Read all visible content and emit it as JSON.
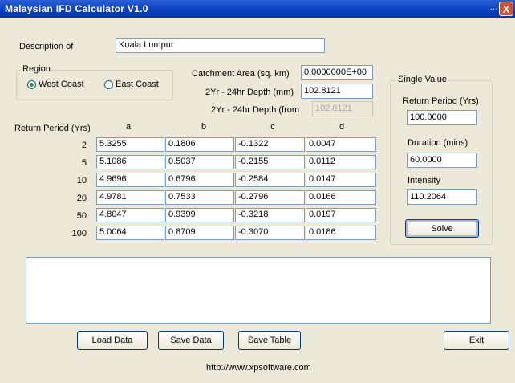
{
  "window": {
    "title": "Malaysian IFD Calculator V1.0",
    "title_dots": "...",
    "close_glyph": "X"
  },
  "description": {
    "label": "Description of",
    "value": "Kuala Lumpur"
  },
  "region": {
    "legend": "Region",
    "west_label": "West Coast",
    "east_label": "East Coast",
    "selected": "West Coast"
  },
  "catchment": {
    "label": "Catchment Area (sq. km)",
    "value": "0.0000000E+00"
  },
  "depth24": {
    "label": "2Yr - 24hr Depth (mm)",
    "value": "102.8121"
  },
  "depth24_from": {
    "label": "2Yr - 24hr Depth (from",
    "value": "102.8121"
  },
  "table": {
    "return_label": "Return Period (Yrs)",
    "columns": [
      "a",
      "b",
      "c",
      "d"
    ],
    "rows": [
      {
        "period": "2",
        "values": [
          "5.3255",
          "0.1806",
          "-0.1322",
          "0.0047"
        ]
      },
      {
        "period": "5",
        "values": [
          "5.1086",
          "0.5037",
          "-0.2155",
          "0.0112"
        ]
      },
      {
        "period": "10",
        "values": [
          "4.9696",
          "0.6796",
          "-0.2584",
          "0.0147"
        ]
      },
      {
        "period": "20",
        "values": [
          "4.9781",
          "0.7533",
          "-0.2796",
          "0.0166"
        ]
      },
      {
        "period": "50",
        "values": [
          "4.8047",
          "0.9399",
          "-0.3218",
          "0.0197"
        ]
      },
      {
        "period": "100",
        "values": [
          "5.0064",
          "0.8709",
          "-0.3070",
          "0.0186"
        ]
      }
    ]
  },
  "single": {
    "legend": "Single Value",
    "return_label": "Return Period (Yrs)",
    "return_value": "100.0000",
    "duration_label": "Duration (mins)",
    "duration_value": "60.0000",
    "intensity_label": "Intensity",
    "intensity_value": "110.2064",
    "solve_label": "Solve"
  },
  "buttons": {
    "load": "Load Data",
    "save_data": "Save Data",
    "save_table": "Save Table",
    "exit": "Exit"
  },
  "footer": {
    "url": "http://www.xpsoftware.com"
  }
}
